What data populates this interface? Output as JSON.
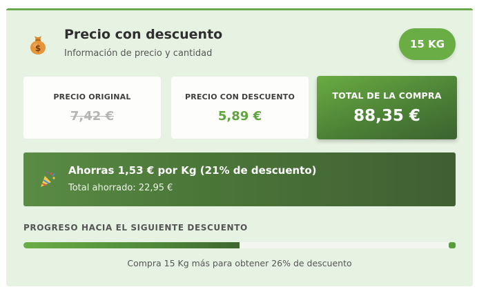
{
  "header": {
    "title": "Precio con descuento",
    "subtitle": "Información de precio y cantidad",
    "quantity_badge": "15 KG",
    "icon": "money-bag-icon"
  },
  "prices": {
    "original_label": "PRECIO ORIGINAL",
    "original_value": "7,42 €",
    "discount_label": "PRECIO CON DESCUENTO",
    "discount_value": "5,89 €",
    "total_label": "TOTAL DE LA COMPRA",
    "total_value": "88,35 €"
  },
  "savings": {
    "icon": "party-popper-icon",
    "headline": "Ahorras 1,53 € por Kg (21% de descuento)",
    "total_saved": "Total ahorrado: 22,95 €"
  },
  "progress": {
    "title": "PROGRESO HACIA EL SIGUIENTE DESCUENTO",
    "percent": 50,
    "note": "Compra 15 Kg más para obtener 26% de descuento"
  },
  "colors": {
    "accent_green": "#6aad45",
    "dark_green": "#405f33",
    "card_background": "#e6f2e2",
    "strikethrough_gray": "#b5b5b5"
  }
}
